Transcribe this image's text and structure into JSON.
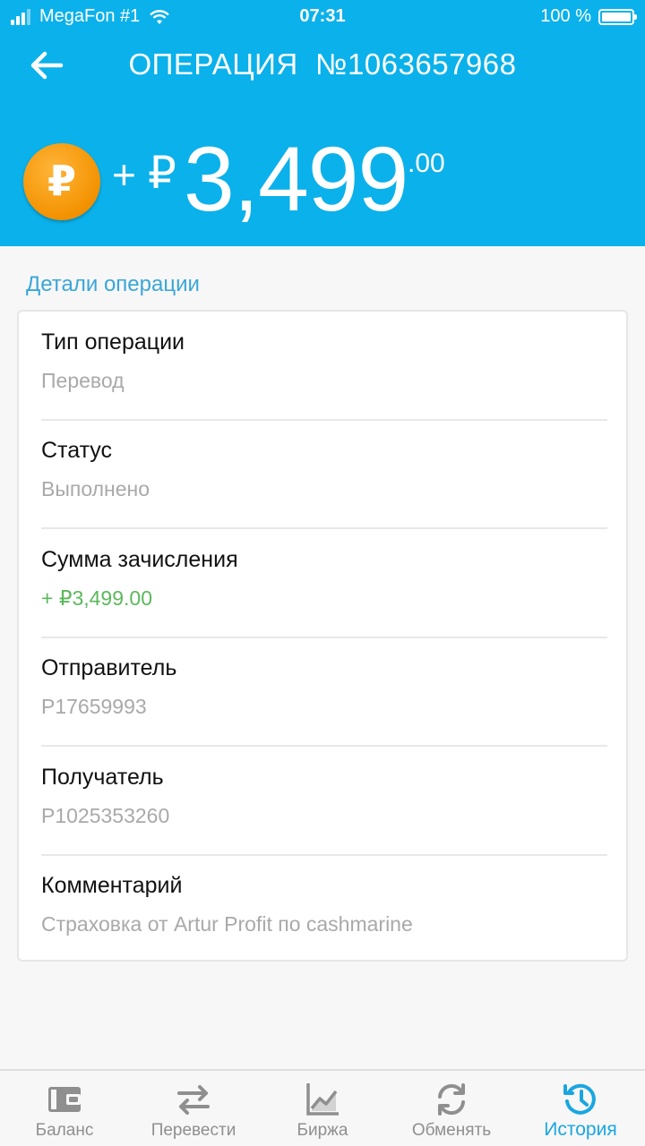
{
  "status_bar": {
    "carrier": "MegaFon #1",
    "time": "07:31",
    "battery": "100 %"
  },
  "header": {
    "title_prefix": "ОПЕРАЦИЯ",
    "title_number": "№1063657968",
    "amount_sign": "+",
    "currency_symbol": "₽",
    "amount_main": "3,499",
    "amount_cents": ".00",
    "coin_symbol": "₽"
  },
  "section_title": "Детали операции",
  "details": [
    {
      "label": "Тип операции",
      "value": "Перевод"
    },
    {
      "label": "Статус",
      "value": "Выполнено"
    },
    {
      "label": "Сумма зачисления",
      "value": "+  ₽3,499.00"
    },
    {
      "label": "Отправитель",
      "value": "P17659993"
    },
    {
      "label": "Получатель",
      "value": "P1025353260"
    },
    {
      "label": "Комментарий",
      "value": "Страховка от Artur Profit по cashmarine"
    }
  ],
  "tabs": [
    {
      "label": "Баланс",
      "icon": "wallet-icon"
    },
    {
      "label": "Перевести",
      "icon": "transfer-arrows-icon"
    },
    {
      "label": "Биржа",
      "icon": "chart-icon"
    },
    {
      "label": "Обменять",
      "icon": "exchange-refresh-icon"
    },
    {
      "label": "История",
      "icon": "history-clock-icon",
      "active": true
    }
  ],
  "colors": {
    "header_bg": "#0bb1ea",
    "accent": "#1aa6e0",
    "positive": "#5cb85c",
    "coin": "#f39200"
  }
}
